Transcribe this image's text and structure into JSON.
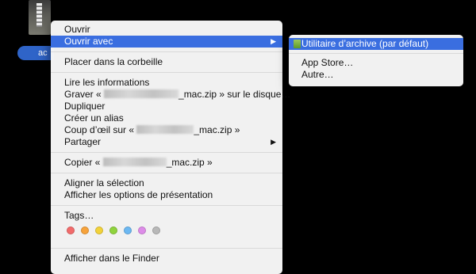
{
  "desktop": {
    "file_label": "ac"
  },
  "menu": {
    "items": [
      {
        "label": "Ouvrir"
      },
      {
        "label": "Ouvrir avec",
        "arrow": "▶"
      },
      {
        "label": "Placer dans la corbeille"
      },
      {
        "label": "Lire les informations"
      },
      {
        "label_start": "Graver « ",
        "label_mid": "_mac.zip » sur le disque…"
      },
      {
        "label": "Dupliquer"
      },
      {
        "label": "Créer un alias"
      },
      {
        "label_start": "Coup d’œil sur « ",
        "label_mid": "_mac.zip »"
      },
      {
        "label": "Partager",
        "arrow": "▶"
      },
      {
        "label_start": "Copier « ",
        "label_mid": "_mac.zip »"
      },
      {
        "label": "Aligner la sélection"
      },
      {
        "label": "Afficher les options de présentation"
      },
      {
        "label": "Tags…"
      },
      {
        "label": "Afficher dans le Finder"
      }
    ],
    "tag_colors": [
      "#f26b6b",
      "#f7a33b",
      "#f2d23a",
      "#8fd33d",
      "#6cb8f2",
      "#dd8ce8",
      "#b8b8b8"
    ]
  },
  "submenu": {
    "items": [
      {
        "label": "Utilitaire d’archive (par défaut)"
      },
      {
        "label": "App Store…"
      },
      {
        "label": "Autre…"
      }
    ]
  },
  "colors": {
    "highlight": "#3a6ee0"
  }
}
